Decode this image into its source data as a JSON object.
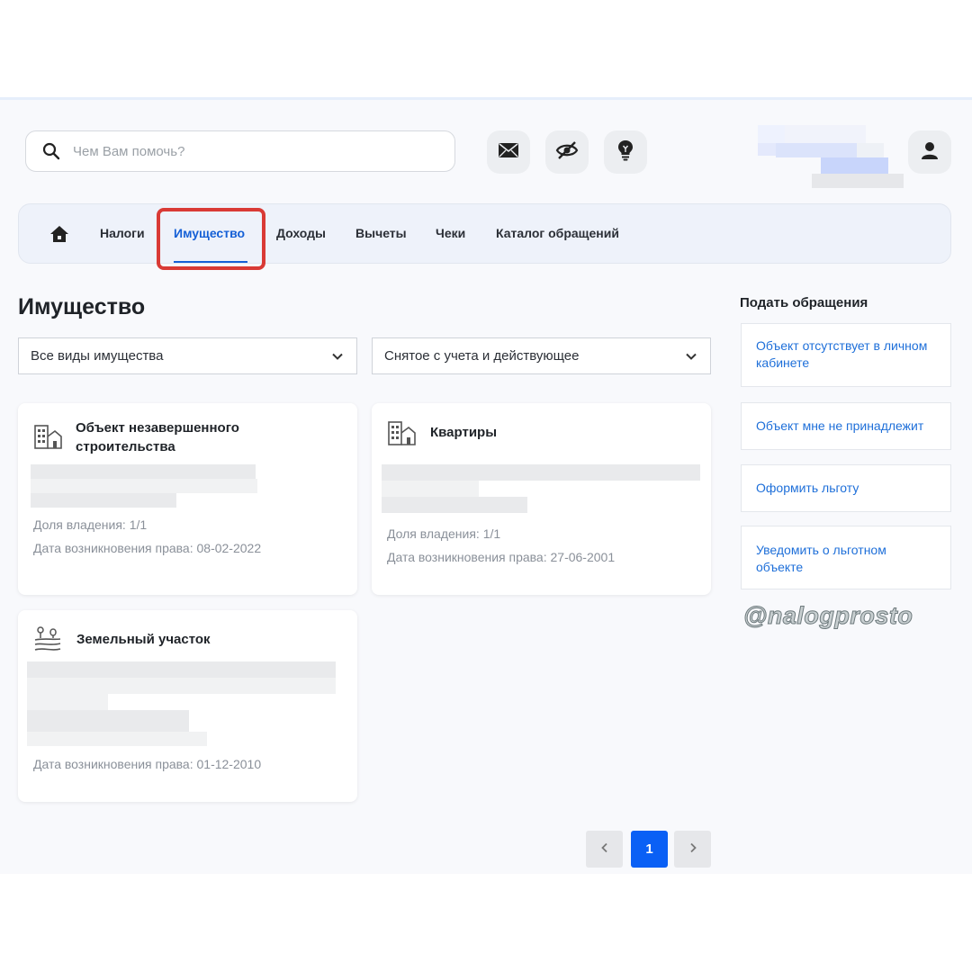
{
  "search": {
    "placeholder": "Чем Вам помочь?"
  },
  "header_icons": [
    "mail-icon",
    "eye-off-icon",
    "lightbulb-icon",
    "user-icon"
  ],
  "nav": {
    "items": [
      {
        "label": "Налоги"
      },
      {
        "label": "Имущество"
      },
      {
        "label": "Доходы"
      },
      {
        "label": "Вычеты"
      },
      {
        "label": "Чеки"
      },
      {
        "label": "Каталог обращений"
      }
    ],
    "active": "Имущество"
  },
  "page_title": "Имущество",
  "filters": {
    "type": "Все виды имущества",
    "status": "Снятое с учета и действующее"
  },
  "cards": [
    {
      "title": "Объект незавершенного строительства",
      "share": "Доля владения: 1/1",
      "date": "Дата возникновения права: 08-02-2022"
    },
    {
      "title": "Квартиры",
      "share": "Доля владения: 1/1",
      "date": "Дата возникновения права: 27-06-2001"
    },
    {
      "title": "Земельный участок",
      "date": "Дата возникновения права: 01-12-2010"
    }
  ],
  "sidebar": {
    "title": "Подать обращения",
    "links": [
      "Объект отсутствует в личном кабинете",
      "Объект мне не принадлежит",
      "Оформить льготу",
      "Уведомить о льготном объекте"
    ]
  },
  "watermark": "@nalogprosto",
  "pagination": {
    "current": "1"
  },
  "colors": {
    "accent": "#0a60f5",
    "link": "#1e6fd9",
    "highlight": "#d93a35"
  }
}
